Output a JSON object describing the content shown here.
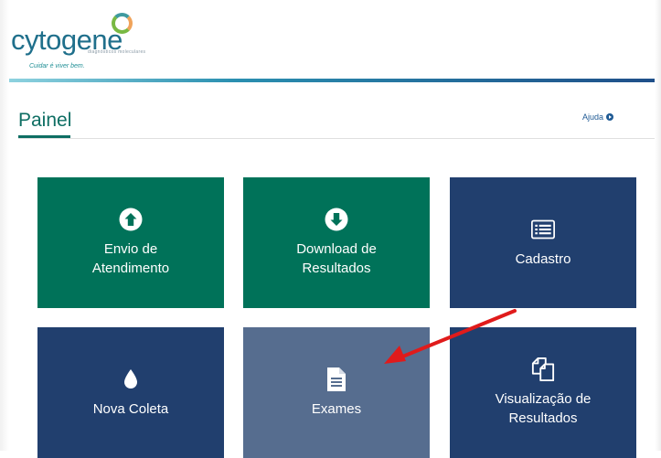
{
  "brand": {
    "logo_text": "cytogene",
    "logo_subtitle": "diagnósticos moleculares",
    "tagline": "Cuidar é viver bem."
  },
  "page": {
    "title": "Painel",
    "help_label": "Ajuda"
  },
  "colors": {
    "tile_green": "#007259",
    "tile_navy": "#213f6e",
    "tile_selected": "#566d8f",
    "accent_teal": "#0e6e63",
    "annotation_arrow": "#e01b1b"
  },
  "tiles": [
    {
      "line1": "Envio de",
      "line2": "Atendimento",
      "icon": "upload-circle-icon"
    },
    {
      "line1": "Download de",
      "line2": "Resultados",
      "icon": "download-circle-icon"
    },
    {
      "line1": "Cadastro",
      "line2": "",
      "icon": "list-icon"
    },
    {
      "line1": "Nova Coleta",
      "line2": "",
      "icon": "drop-icon"
    },
    {
      "line1": "Exames",
      "line2": "",
      "icon": "document-icon"
    },
    {
      "line1": "Visualização de",
      "line2": "Resultados",
      "icon": "copy-icon"
    }
  ]
}
